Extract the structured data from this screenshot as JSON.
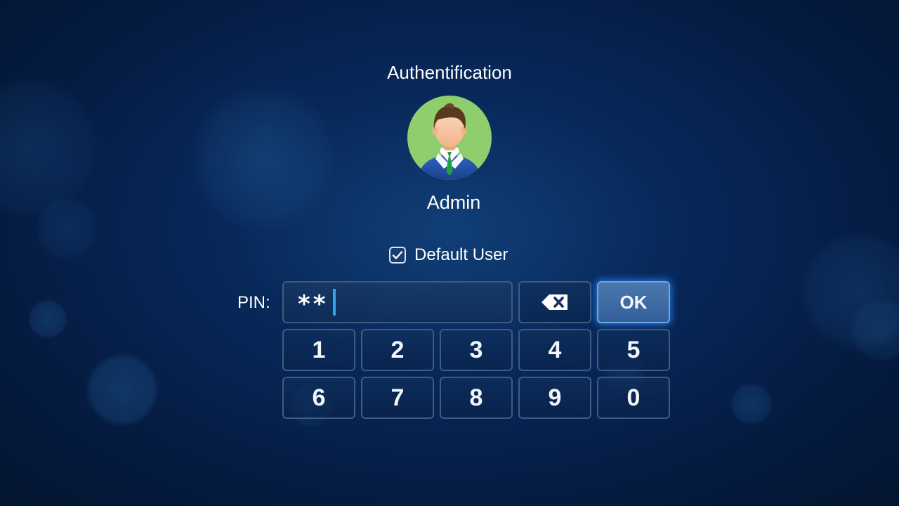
{
  "auth": {
    "title": "Authentification",
    "user_name": "Admin",
    "default_user": {
      "label": "Default User",
      "checked": true
    }
  },
  "pin": {
    "label": "PIN:",
    "masked_value": "**"
  },
  "actions": {
    "backspace_icon": "backspace-icon",
    "ok_label": "OK"
  },
  "keypad": {
    "keys": [
      "1",
      "2",
      "3",
      "4",
      "5",
      "6",
      "7",
      "8",
      "9",
      "0"
    ]
  },
  "colors": {
    "background": "#07234d",
    "caret": "#29a7ef",
    "ok_button": "#3e6aa3",
    "avatar_bg": "#8fce6c"
  }
}
